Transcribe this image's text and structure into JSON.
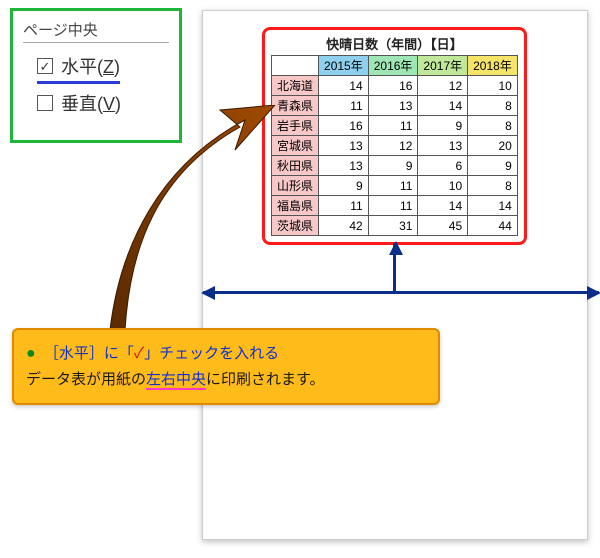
{
  "settings": {
    "title": "ページ中央",
    "horizontal": {
      "label_main": "水平",
      "shortcut": "Z",
      "checked": true
    },
    "vertical": {
      "label_main": "垂直",
      "shortcut": "V",
      "checked": false
    }
  },
  "chart_data": {
    "type": "table",
    "title": "快晴日数（年間）【日】",
    "columns": [
      "2015年",
      "2016年",
      "2017年",
      "2018年"
    ],
    "rows": [
      {
        "label": "北海道",
        "values": [
          14,
          16,
          12,
          10
        ]
      },
      {
        "label": "青森県",
        "values": [
          11,
          13,
          14,
          8
        ]
      },
      {
        "label": "岩手県",
        "values": [
          16,
          11,
          9,
          8
        ]
      },
      {
        "label": "宮城県",
        "values": [
          13,
          12,
          13,
          20
        ]
      },
      {
        "label": "秋田県",
        "values": [
          13,
          9,
          6,
          9
        ]
      },
      {
        "label": "山形県",
        "values": [
          9,
          11,
          10,
          8
        ]
      },
      {
        "label": "福島県",
        "values": [
          11,
          11,
          14,
          14
        ]
      },
      {
        "label": "茨城県",
        "values": [
          42,
          31,
          45,
          44
        ]
      }
    ]
  },
  "callout": {
    "line1_pre": "［",
    "line1_kw": "水平",
    "line1_mid1": "］に「",
    "line1_check": "✓",
    "line1_mid2": "」チェックを入れる",
    "line2_pre": "データ表が用紙の",
    "line2_kw": "左右中央",
    "line2_post": "に印刷されます。"
  }
}
